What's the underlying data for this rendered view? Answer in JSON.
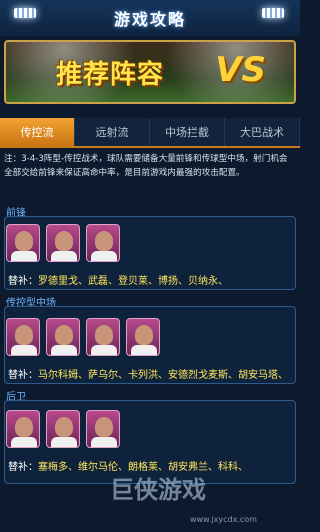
{
  "header": {
    "title": "游戏攻略"
  },
  "banner": {
    "title": "推荐阵容",
    "vs": "VS"
  },
  "tabs": [
    {
      "label": "传控流",
      "active": true
    },
    {
      "label": "远射流",
      "active": false
    },
    {
      "label": "中场拦截",
      "active": false
    },
    {
      "label": "大巴战术",
      "active": false
    }
  ],
  "note": {
    "text": "注：3-4-3阵型-传控战术，球队需要储备大量前锋和传球型中场，射门机会全部交给前锋来保证高命中率，是目前游戏内最强的攻击配置。"
  },
  "sections": [
    {
      "title": "前锋",
      "cards": 3,
      "subs_label": "替补：",
      "subs_text": "罗德里戈、武磊、登贝莱、博扬、贝纳永、"
    },
    {
      "title": "传控型中场",
      "cards": 4,
      "subs_label": "替补：",
      "subs_text": "马尔科姆、萨乌尔、卡列洪、安德烈戈麦斯、胡安马塔、"
    },
    {
      "title": "后卫",
      "cards": 3,
      "subs_label": "替补：",
      "subs_text": "塞梅多、维尔马伦、朗格莱、胡安弗兰、科科、"
    }
  ],
  "watermark": {
    "text": "巨侠游戏",
    "url": "www.jxycdx.com"
  },
  "colors": {
    "accent": "#f3a233",
    "subs": "#ffe85a",
    "section_title": "#6fb8ff"
  }
}
